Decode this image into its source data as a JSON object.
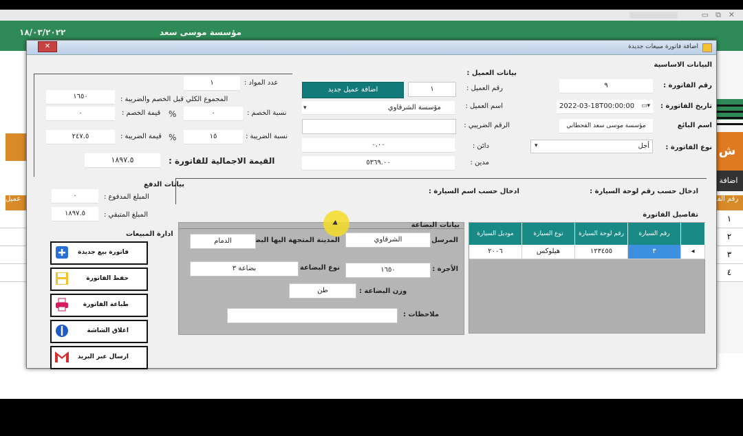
{
  "app": {
    "header_title": "مؤسسة موسى سعد",
    "header_date": "١٨/٠٣/٢٠٢٢",
    "orange_tile": "ش",
    "dark_tab": "اضافة",
    "bg_table_header": "رقم الفـ",
    "bg_rows_right": [
      "١",
      "٢",
      "٣",
      "٤"
    ],
    "bg_left_header": "عميل"
  },
  "dialog": {
    "title": "اضافة فاتورة مبيعات جديدة",
    "close": "✕",
    "basic": {
      "section": "البيانات الاساسية",
      "invoice_no_label": "رقم الفاتورة :",
      "invoice_no": "٩",
      "invoice_date_label": "تاريخ الفاتورة :",
      "invoice_date": "2022-03-18T00:00:00",
      "seller_label": "اسم البائع",
      "seller": "مؤسسة موسى سعد القحطاني",
      "invoice_type_label": "نوع الفاتورة :",
      "invoice_type": "أجل"
    },
    "client": {
      "section": "بيانات العميل :",
      "client_no_label": "رقم العميل :",
      "client_no": "١",
      "add_client_button": "اضافة عميل جديد",
      "client_name_label": "اسم العميل :",
      "client_name": "مؤسسة الشرقاوي",
      "tax_no_label": "الرقم الضريبي :",
      "tax_no": "",
      "debit_label": "دائن :",
      "debit": "٠.٠٠",
      "credit_label": "مدين :",
      "credit": "٥٣٦٩.٠٠"
    },
    "totals": {
      "items_count_label": "عدد المواد :",
      "items_count": "١",
      "subtotal_label": "المجموع الكلي قبل الخصم والضريبة :",
      "subtotal": "١٦٥٠",
      "discount_rate_label": "نسبة الخصم :",
      "discount_rate": "٠",
      "discount_value_label": "قيمة الخصم :",
      "discount_value": "٠",
      "tax_rate_label": "نسبة الضريبة :",
      "tax_rate": "١٥",
      "tax_value_label": "قيمة الضريبة :",
      "tax_value": "٢٤٧.٥",
      "total_label": "القيمة الاجمالية للفاتورة :",
      "total": "١٨٩٧.٥",
      "percent": "%"
    },
    "payment": {
      "section": "بيانات الدفع",
      "paid_label": "المبلغ المدفوع :",
      "paid": "٠",
      "remaining_label": "المبلغ المتبقي :",
      "remaining": "١٨٩٧.٥"
    },
    "search": {
      "by_plate_label": "ادخال حسب رقم لوحة السيارة :",
      "by_name_label": "ادخال حسب اسم السيارة :",
      "details_label": "تفاصيل الفاتورة"
    },
    "grid": {
      "headers": [
        "رقم السيارة",
        "رقم لوحة السيارة",
        "نوع السيارة",
        "موديل السيارة"
      ],
      "row": {
        "marker": "◂",
        "car_no": "٣",
        "plate": "١٢٣٤٥٥",
        "type": "هيلوكس",
        "model": "٢٠٠٦"
      }
    },
    "cargo": {
      "section": "بيانات البضاعة",
      "sender_label": "المرسل :",
      "sender": "الشرقاوي",
      "dest_label": "المدينة المتجهة اليها البضاعة :",
      "dest": "الدمام",
      "fare_label": "الأجرة :",
      "fare": "١٦٥٠",
      "goods_type_label": "نوع البضاعة :",
      "goods_type": "بضاعة ٣",
      "weight_label": "وزن البضاعة :",
      "weight": "طن",
      "notes_label": "ملاحظات :",
      "notes": ""
    },
    "sales_mgmt": {
      "section": "ادارة المبيعات",
      "new_invoice": "فاتورة بيع جديدة",
      "save_invoice": "حفظ الفاتورة",
      "print_invoice": "طباعة الفاتورة",
      "close_window": "اغلاق الشاشة",
      "send_email": "ارسال عبر البريد"
    }
  }
}
